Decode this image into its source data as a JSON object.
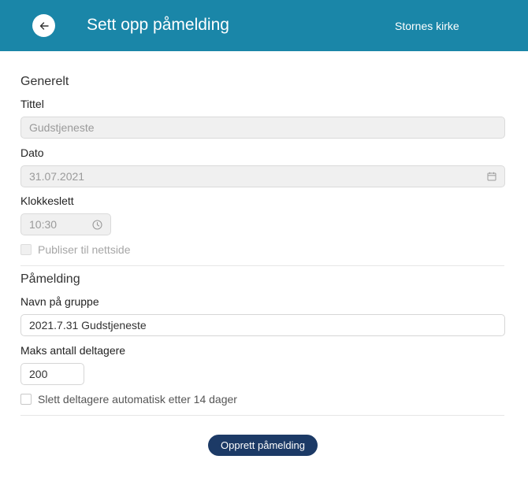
{
  "header": {
    "back_icon": "arrow-left-icon",
    "title": "Sett opp påmelding",
    "organization": "Stornes kirke",
    "background_color": "#1a86a8"
  },
  "general": {
    "section_title": "Generelt",
    "title_label": "Tittel",
    "title_value": "Gudstjeneste",
    "date_label": "Dato",
    "date_value": "31.07.2021",
    "date_icon": "calendar-icon",
    "time_label": "Klokkeslett",
    "time_value": "10:30",
    "time_icon": "clock-icon",
    "publish_label": "Publiser til nettside",
    "publish_checked": false
  },
  "registration": {
    "section_title": "Påmelding",
    "group_name_label": "Navn på gruppe",
    "group_name_value": "2021.7.31 Gudstjeneste",
    "max_participants_label": "Maks antall deltagere",
    "max_participants_value": "200",
    "auto_delete_label": "Slett deltagere automatisk etter 14 dager",
    "auto_delete_checked": false
  },
  "actions": {
    "submit_label": "Opprett påmelding",
    "submit_color": "#1c3a66"
  }
}
